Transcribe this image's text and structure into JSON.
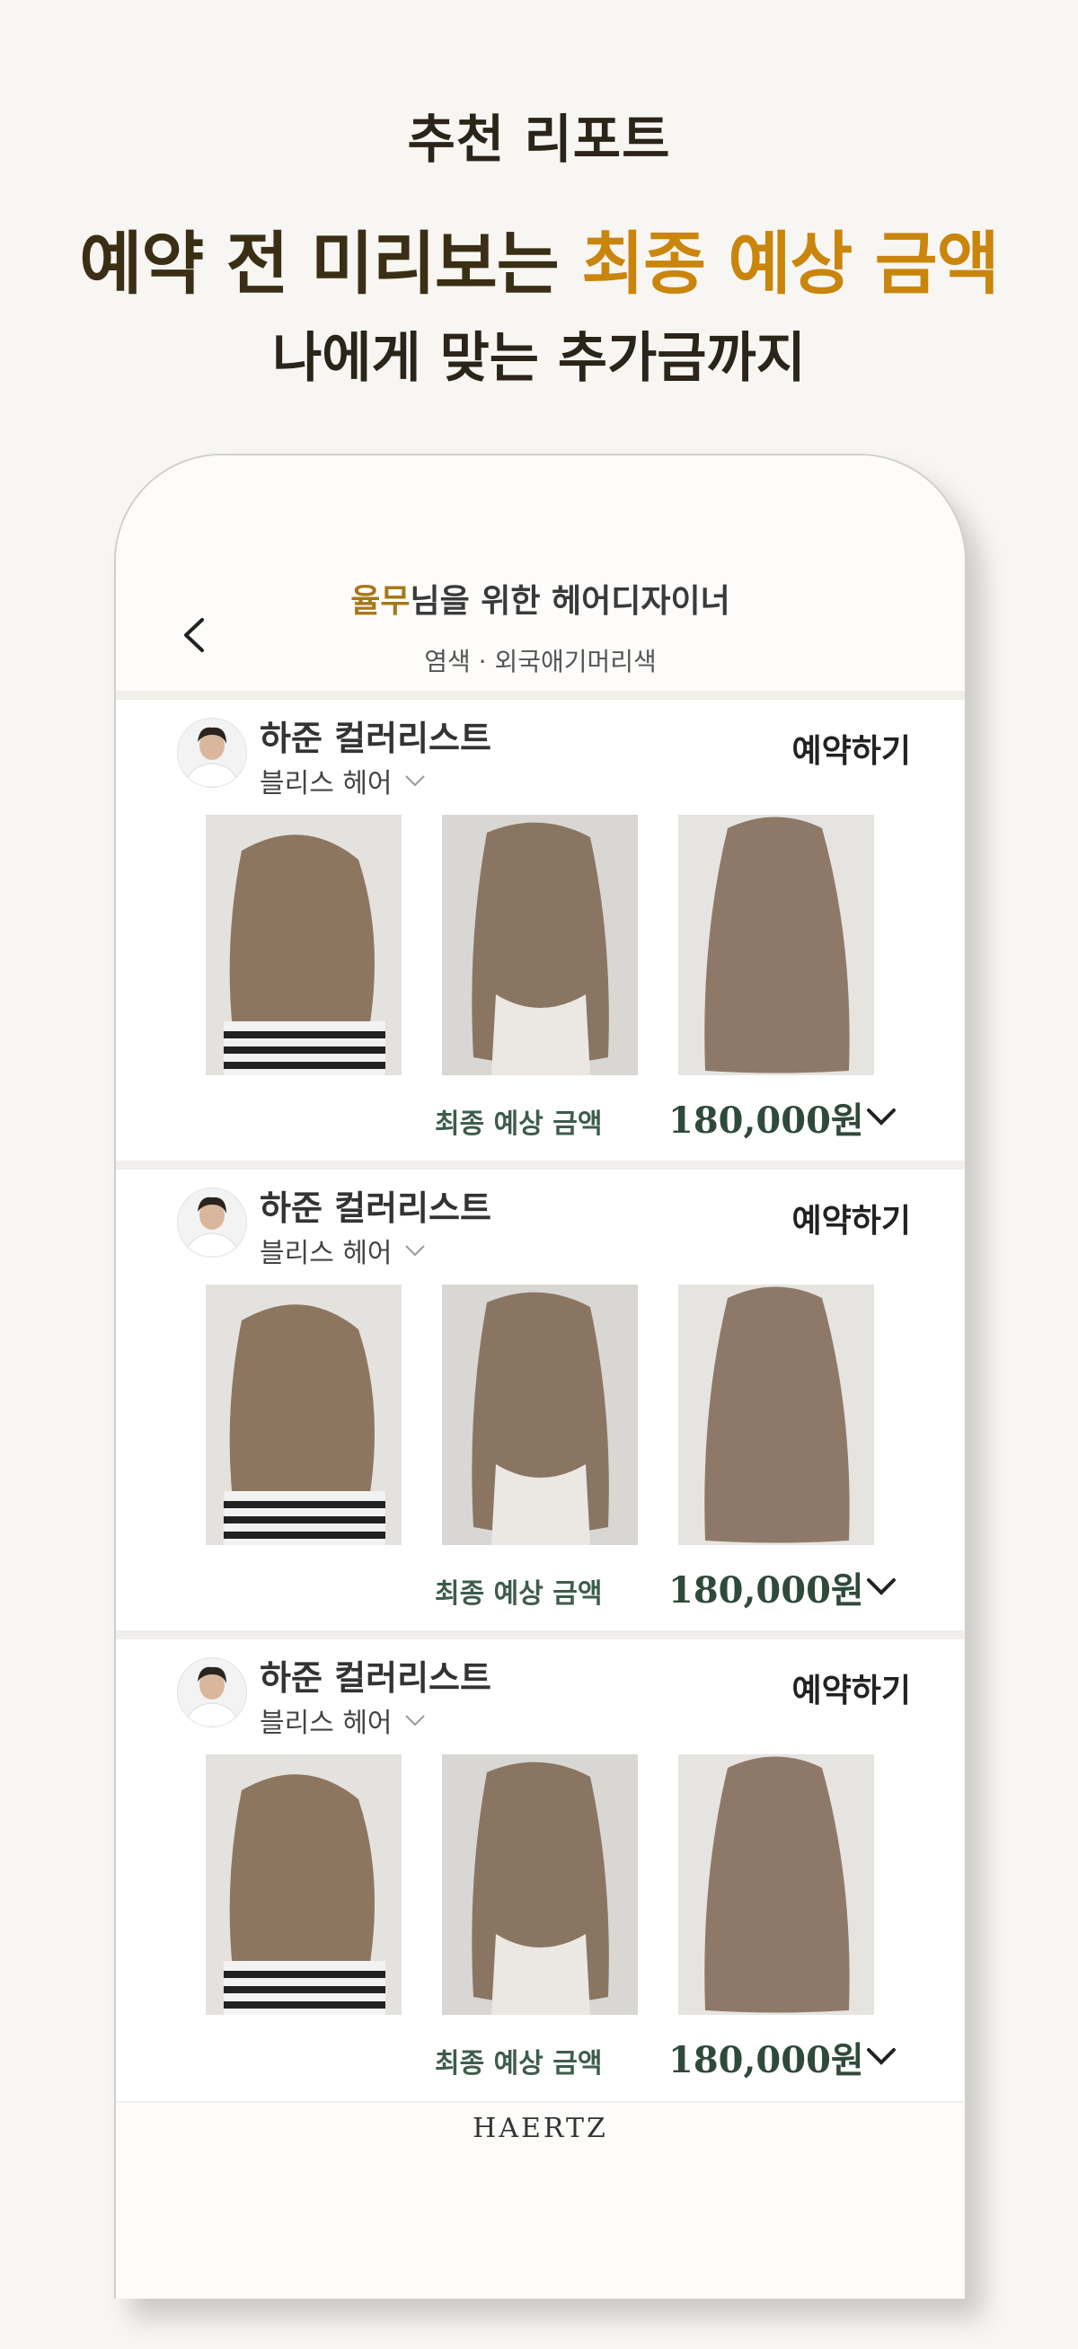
{
  "hero": {
    "eyebrow": "추천 리포트",
    "headline_prefix": "예약 전 미리보는 ",
    "headline_accent": "최종 예상 금액",
    "subline": "나에게 맞는 추가금까지"
  },
  "colors": {
    "accent": "#c9850c",
    "price_green": "#2f4a3a",
    "name_gold": "#a6781a"
  },
  "header": {
    "back_icon": "chevron-left-icon",
    "title_name": "율무",
    "title_rest": "님을 위한 헤어디자이너",
    "subtitle": "염색 · 외국애기머리색"
  },
  "cards": [
    {
      "designer": "하준 컬러리스트",
      "salon": "블리스 헤어",
      "book": "예약하기",
      "price_label": "최종 예상 금액",
      "price": "180,000원"
    },
    {
      "designer": "하준 컬러리스트",
      "salon": "블리스 헤어",
      "book": "예약하기",
      "price_label": "최종 예상 금액",
      "price": "180,000원"
    },
    {
      "designer": "하준 컬러리스트",
      "salon": "블리스 헤어",
      "book": "예약하기",
      "price_label": "최종 예상 금액",
      "price": "180,000원"
    }
  ],
  "footer": {
    "logo": "HAERTZ"
  }
}
